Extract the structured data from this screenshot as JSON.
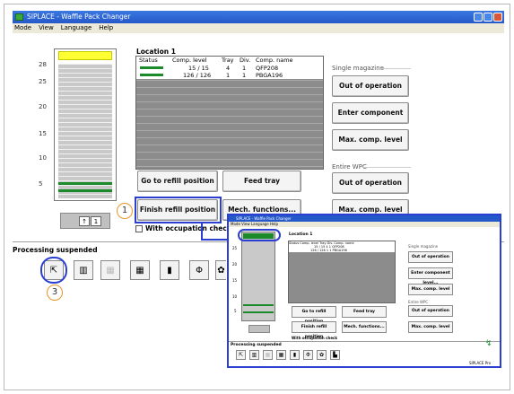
{
  "window": {
    "title": "SIPLACE - Waffle Pack Changer",
    "menu": [
      "Mode",
      "View",
      "Language",
      "Help"
    ]
  },
  "magazine": {
    "ticks": [
      "28",
      "25",
      "20",
      "15",
      "10",
      "5"
    ],
    "nav_label": "1"
  },
  "location": {
    "title": "Location 1",
    "columns": [
      "Status",
      "Comp. level",
      "Tray",
      "Div.",
      "Comp. name"
    ],
    "rows": [
      {
        "comp_level": "15 / 15",
        "tray": "4",
        "div": "1",
        "comp_name": "QFP208"
      },
      {
        "comp_level": "126 / 126",
        "tray": "1",
        "div": "1",
        "comp_name": "PBGA196"
      }
    ]
  },
  "buttons": {
    "goto_refill": "Go to refill position",
    "feed_tray": "Feed tray",
    "finish_refill": "Finish refill position",
    "mech_functions": "Mech. functions...",
    "with_occupation": "With occupation check"
  },
  "single_magazine": {
    "label": "Single magazine",
    "out_of_operation": "Out of operation",
    "enter_comp_level": "Enter component level...",
    "max_comp_level": "Max. comp. level"
  },
  "entire_wpc": {
    "label": "Entire WPC",
    "out_of_operation": "Out of operation",
    "max_comp_level": "Max. comp. level"
  },
  "status": {
    "processing": "Processing suspended"
  },
  "callouts": [
    "1",
    "2",
    "3"
  ],
  "inset": {
    "title": "SIPLACE - Waffle Pack Changer",
    "menu": "Mode  View  Language  Help",
    "location_title": "Location 1",
    "columns": "Status  Comp. level  Tray  Div.  Comp. name",
    "row1": "15 / 15    4    1   QFP208",
    "row2": "126 / 126    1    1   PBGA196",
    "ticks": [
      "25",
      "20",
      "15",
      "10",
      "5"
    ],
    "goto_refill": "Go to refill position",
    "feed_tray": "Feed tray",
    "finish_refill": "Finish refill position",
    "mech_functions": "Mech. functions...",
    "with_occupation": "With occupation check",
    "single_magazine": "Single magazine",
    "out_of_operation": "Out of operation",
    "enter_comp_level": "Enter component level...",
    "max_comp_level": "Max. comp. level",
    "entire_wpc": "Entire WPC",
    "out_of_operation2": "Out of operation",
    "max_comp_level2": "Max. comp. level",
    "processing": "Processing suspended",
    "footer": "SIPLACE Pro"
  }
}
